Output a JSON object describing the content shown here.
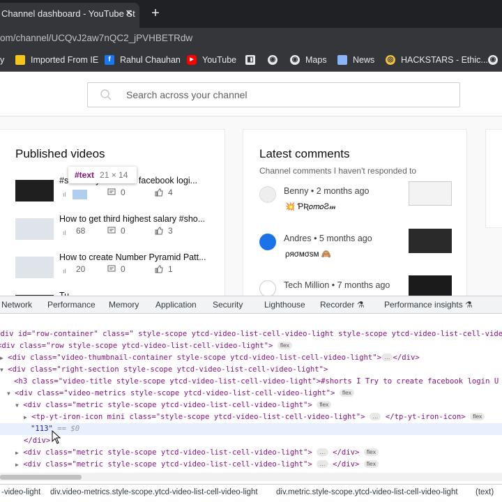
{
  "browser": {
    "tab_title": "Channel dashboard - YouTube St",
    "tab_close": "✕",
    "new_tab": "+",
    "url": "om/channel/UCQvJ2aw7nQC2_jPVHBETRdw"
  },
  "bookmarks": [
    {
      "label": "y",
      "icon": "bookmark-icon"
    },
    {
      "label": "Imported From IE",
      "icon": "folder-icon"
    },
    {
      "label": "Rahul Chauhan",
      "icon": "facebook-icon"
    },
    {
      "label": "YouTube",
      "icon": "youtube-icon"
    },
    {
      "label": "",
      "icon": "app-icon"
    },
    {
      "label": "",
      "icon": "globe-icon"
    },
    {
      "label": "Maps",
      "icon": "maps-icon"
    },
    {
      "label": "News",
      "icon": "news-icon"
    },
    {
      "label": "HACKSTARS - Ethic...",
      "icon": "hackstars-icon"
    },
    {
      "label": "",
      "icon": "globe-icon"
    }
  ],
  "search": {
    "placeholder": "Search across your channel"
  },
  "published": {
    "heading": "Published videos",
    "videos": [
      {
        "title": "#sh... I Try to create facebook logi...",
        "views": "",
        "comments": "0",
        "likes": "4",
        "thumb": "dark"
      },
      {
        "title": "How to get third highest salary #sho...",
        "views": "68",
        "comments": "0",
        "likes": "3",
        "thumb": "light"
      },
      {
        "title": "How to create Number Pyramid Patt...",
        "views": "20",
        "comments": "0",
        "likes": "1",
        "thumb": "light"
      },
      {
        "title": "Tu... ...",
        "views": "",
        "comments": "",
        "likes": "",
        "thumb": "dark"
      }
    ]
  },
  "comments": {
    "heading": "Latest comments",
    "subtitle": "Channel comments I haven't responded to",
    "items": [
      {
        "author": "Benny • 2 months ago",
        "text": "💥 ƤƦ𝑜𝑚𝑜Ƨ𝓂"
      },
      {
        "author": "Andres • 5 months ago",
        "text": "ρяσмσѕм 🙈"
      },
      {
        "author": "Tech Million • 7 months ago",
        "text": ""
      }
    ]
  },
  "tooltip": {
    "tag": "#text",
    "dims": "21 × 14"
  },
  "devtools": {
    "tabs": [
      "Network",
      "Performance",
      "Memory",
      "Application",
      "Security",
      "Lighthouse",
      "Recorder ⚗",
      "Performance insights ⚗"
    ],
    "lines": [
      "<div id=\"row-container\" class=\" style-scope ytcd-video-list-cell-video-light style-scope ytcd-video-list-cell-vide",
      "<div class=\"row style-scope ytcd-video-list-cell-video-light\">",
      "<div class=\"video-thumbnail-container style-scope ytcd-video-list-cell-video-light\">",
      "<div class=\"right-section style-scope ytcd-video-list-cell-video-light\">",
      "<h3 class=\"video-title style-scope ytcd-video-list-cell-video-light\">#shorts I Try to create facebook login U",
      "<div class=\"video-metrics style-scope ytcd-video-list-cell-video-light\">",
      "<div class=\"metric style-scope ytcd-video-list-cell-video-light\">",
      "<tp-yt-iron-icon mini class=\"style-scope ytcd-video-list-cell-video-light\">",
      "\"113\"",
      "</div>",
      "<div class=\"metric style-scope ytcd-video-list-cell-video-light\">",
      "<div class=\"metric style-scope ytcd-video-list-cell-video-light\">"
    ],
    "flex": "flex",
    "ellipsis": "…",
    "close_div": "</div>",
    "close_icon": "</tp-yt-iron-icon>",
    "dollar0": "== $0",
    "breadcrumbs": [
      "-video-light",
      "div.video-metrics.style-scope.ytcd-video-list-cell-video-light",
      "div.metric.style-scope.ytcd-video-list-cell-video-light",
      "(text)"
    ]
  }
}
